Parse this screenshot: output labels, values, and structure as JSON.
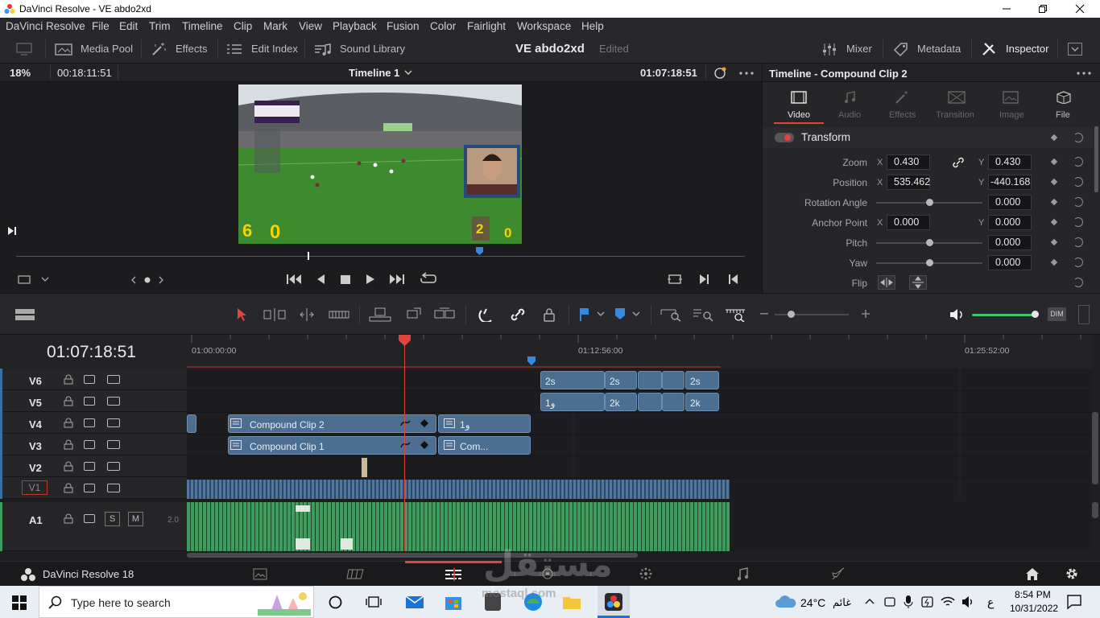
{
  "window": {
    "title": "DaVinci Resolve - VE abdo2xd",
    "min_icon": "minimize-icon",
    "max_icon": "maximize-icon",
    "close_icon": "close-icon"
  },
  "menu": [
    "DaVinci Resolve",
    "File",
    "Edit",
    "Trim",
    "Timeline",
    "Clip",
    "Mark",
    "View",
    "Playback",
    "Fusion",
    "Color",
    "Fairlight",
    "Workspace",
    "Help"
  ],
  "toolbar": {
    "media_pool": "Media Pool",
    "effects": "Effects",
    "edit_index": "Edit Index",
    "sound_library": "Sound Library",
    "project": "VE abdo2xd",
    "status": "Edited",
    "mixer": "Mixer",
    "metadata": "Metadata",
    "inspector": "Inspector"
  },
  "viewer": {
    "zoom": "18%",
    "source_tc": "00:18:11:51",
    "timeline_name": "Timeline 1",
    "record_tc": "01:07:18:51",
    "score_left_a": "6",
    "score_left_b": "0",
    "score_right_a": "2",
    "score_right_b": "0",
    "playhead_fraction": 0.4
  },
  "inspector": {
    "title": "Timeline - Compound Clip 2",
    "tabs": [
      "Video",
      "Audio",
      "Effects",
      "Transition",
      "Image",
      "File"
    ],
    "active_tab": "Video",
    "section": "Transform",
    "zoom_label": "Zoom",
    "zoom_x": "0.430",
    "zoom_y": "0.430",
    "position_label": "Position",
    "position_x": "535.462",
    "position_y": "-440.168",
    "rotation_label": "Rotation Angle",
    "rotation": "0.000",
    "anchor_label": "Anchor Point",
    "anchor_x": "0.000",
    "anchor_y": "0.000",
    "pitch_label": "Pitch",
    "pitch": "0.000",
    "yaw_label": "Yaw",
    "yaw": "0.000",
    "flip_label": "Flip",
    "x_letter": "X",
    "y_letter": "Y"
  },
  "timeline": {
    "timecode": "01:07:18:51",
    "ruler": [
      "01:00:00:00",
      "01:12:56:00",
      "01:25:52:00"
    ],
    "tracks": [
      "V6",
      "V5",
      "V4",
      "V3",
      "V2",
      "V1",
      "A1"
    ],
    "a1_solo": "S",
    "a1_mute": "M",
    "a1_level": "2.0",
    "clips": {
      "v6a": "2s",
      "v6b": "2s",
      "v6c": "2s",
      "v5a": "1ﻭ",
      "v5b": "2k",
      "v5c": "2k",
      "v4a": "Compound Clip 2",
      "v4b": "1ﻭ",
      "v3a": "Compound Clip 1",
      "v3b": "Com..."
    }
  },
  "pagebar": {
    "app": "DaVinci Resolve 18"
  },
  "taskbar": {
    "search_placeholder": "Type here to search",
    "weather": "24°C",
    "weather_text": "غائم",
    "lang": "ع",
    "time": "8:54 PM",
    "date": "10/31/2022",
    "watermark": "مستقل",
    "watermark_url": "mostaql.com"
  },
  "colors": {
    "accent": "#e2433c",
    "clip_blue": "#4b6e91",
    "audio_green": "#3f9c5e",
    "marker_blue": "#3a87e0"
  }
}
